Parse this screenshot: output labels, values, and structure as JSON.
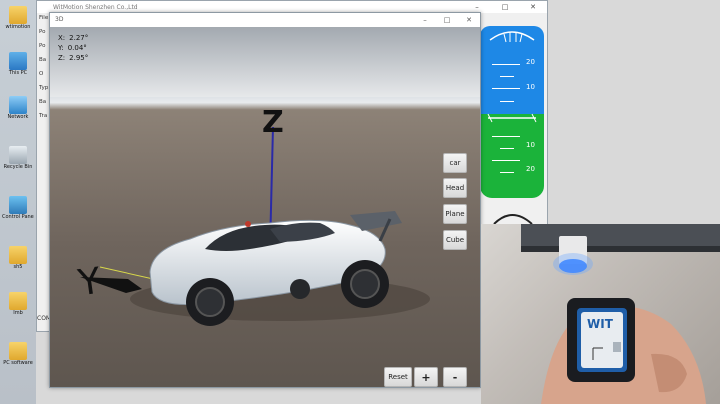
{
  "desktop": {
    "icons": [
      {
        "name": "folder-icon",
        "label": "wtimotion",
        "kind": "folder"
      },
      {
        "name": "this-pc-icon",
        "label": "This PC",
        "kind": "pc"
      },
      {
        "name": "network-icon",
        "label": "Network",
        "kind": "net"
      },
      {
        "name": "recycle-bin-icon",
        "label": "Recycle Bin",
        "kind": "bin"
      },
      {
        "name": "control-panel-icon",
        "label": "Control Panel",
        "kind": "ctrl"
      },
      {
        "name": "folder-icon",
        "label": "sh5",
        "kind": "folder"
      },
      {
        "name": "folder-icon",
        "label": "Imb",
        "kind": "folder"
      },
      {
        "name": "folder-icon",
        "label": "PC software",
        "kind": "folder"
      }
    ]
  },
  "bg_app": {
    "title": "WitMotion Shenzhen Co.,Ltd",
    "side_labels": [
      "File",
      "Po",
      "Po",
      "Ba",
      "O",
      "Typ",
      "Ba",
      "Tra"
    ],
    "attitude_numbers": [
      "20",
      "10",
      "10",
      "20"
    ],
    "com_label": "COM"
  },
  "win3d": {
    "title": "3D",
    "axes_readout": [
      {
        "axis": "X:",
        "value": "2.27°"
      },
      {
        "axis": "Y:",
        "value": "0.04°"
      },
      {
        "axis": "Z:",
        "value": "2.95°"
      }
    ],
    "model_buttons": [
      "car",
      "Head",
      "Plane",
      "Cube"
    ],
    "reset_label": "Reset",
    "zoom_in_label": "+",
    "zoom_out_label": "-",
    "axis_label": "Z"
  },
  "colors": {
    "sky": "#1e88e6",
    "ground": "#1bb33a",
    "z_axis": "#2a2aa8",
    "usb_led": "#2f7bff"
  }
}
